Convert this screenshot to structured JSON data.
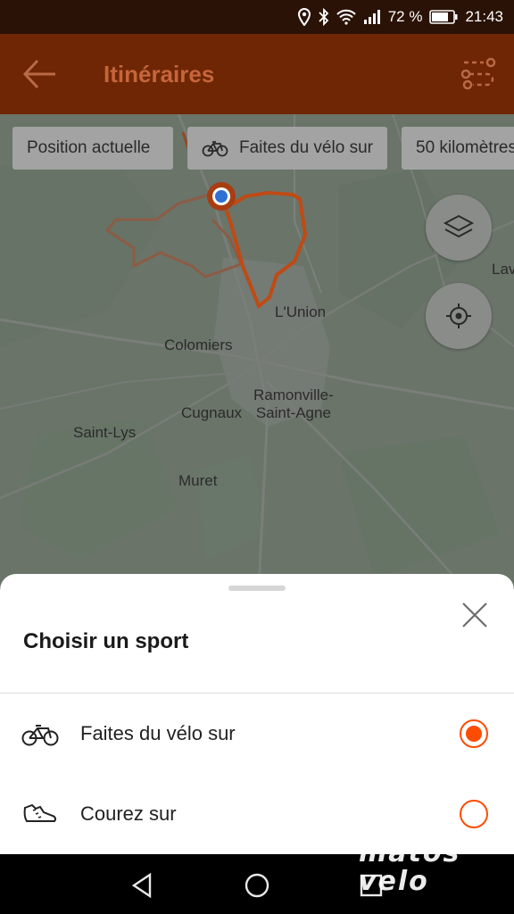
{
  "status": {
    "battery_percent": "72 %",
    "time": "21:43"
  },
  "app_bar": {
    "title": "Itinéraires"
  },
  "filters": {
    "location": "Position actuelle",
    "sport": "Faites du vélo sur",
    "distance": "50 kilomètres"
  },
  "map": {
    "labels": {
      "lunion": "L'Union",
      "colomiers": "Colomiers",
      "ramonville_1": "Ramonville-",
      "ramonville_2": "Saint-Agne",
      "cugnaux": "Cugnaux",
      "saintlys": "Saint-Lys",
      "muret": "Muret",
      "lav": "Lav"
    },
    "route_color": "#c04a14",
    "location_dot_color": "#2f6fd6"
  },
  "sheet": {
    "title": "Choisir un sport",
    "options": [
      {
        "label": "Faites du vélo sur",
        "icon": "bike-icon",
        "selected": true
      },
      {
        "label": "Courez sur",
        "icon": "shoe-icon",
        "selected": false
      }
    ]
  },
  "watermark": {
    "line1": "matos",
    "line2": "velo"
  },
  "colors": {
    "accent": "#fc4c02",
    "app_bar": "#6e2605",
    "status_bar": "#2a1206"
  }
}
